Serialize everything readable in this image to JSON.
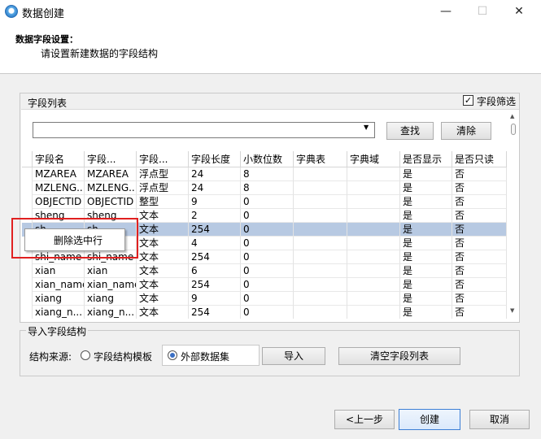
{
  "window": {
    "title": "数据创建",
    "minimize": "—",
    "maximize": "☐",
    "close": "✕"
  },
  "header": {
    "title": "数据字段设置：",
    "subtitle": "请设置新建数据的字段结构"
  },
  "field_list": {
    "group_title": "字段列表",
    "filter_label": "字段筛选",
    "filter_checked": true,
    "search_value": "",
    "search_button": "查找",
    "clear_button": "清除",
    "columns": [
      "字段名",
      "字段...",
      "字段...",
      "字段长度",
      "小数位数",
      "字典表",
      "字典域",
      "是否显示",
      "是否只读"
    ],
    "rows": [
      [
        "MZAREA",
        "MZAREA",
        "浮点型",
        "24",
        "8",
        "",
        "",
        "是",
        "否"
      ],
      [
        "MZLENG...",
        "MZLENG...",
        "浮点型",
        "24",
        "8",
        "",
        "",
        "是",
        "否"
      ],
      [
        "OBJECTID",
        "OBJECTID",
        "整型",
        "9",
        "0",
        "",
        "",
        "是",
        "否"
      ],
      [
        "sheng",
        "sheng",
        "文本",
        "2",
        "0",
        "",
        "",
        "是",
        "否"
      ],
      [
        "sh...",
        "sh...",
        "文本",
        "254",
        "0",
        "",
        "",
        "是",
        "否"
      ],
      [
        "shi",
        "shi",
        "文本",
        "4",
        "0",
        "",
        "",
        "是",
        "否"
      ],
      [
        "shi_name",
        "shi_name",
        "文本",
        "254",
        "0",
        "",
        "",
        "是",
        "否"
      ],
      [
        "xian",
        "xian",
        "文本",
        "6",
        "0",
        "",
        "",
        "是",
        "否"
      ],
      [
        "xian_name",
        "xian_name",
        "文本",
        "254",
        "0",
        "",
        "",
        "是",
        "否"
      ],
      [
        "xiang",
        "xiang",
        "文本",
        "9",
        "0",
        "",
        "",
        "是",
        "否"
      ],
      [
        "xiang_n...",
        "xiang_n...",
        "文本",
        "254",
        "0",
        "",
        "",
        "是",
        "否"
      ]
    ],
    "selected_row": 4
  },
  "context_menu": {
    "item": "删除选中行"
  },
  "import": {
    "group_title": "导入字段结构",
    "source_label": "结构来源:",
    "option_template": "字段结构模板",
    "option_external": "外部数据集",
    "selected": "external",
    "import_button": "导入",
    "clear_list_button": "清空字段列表"
  },
  "footer": {
    "prev_button": "<上一步",
    "create_button": "创建",
    "cancel_button": "取消"
  }
}
